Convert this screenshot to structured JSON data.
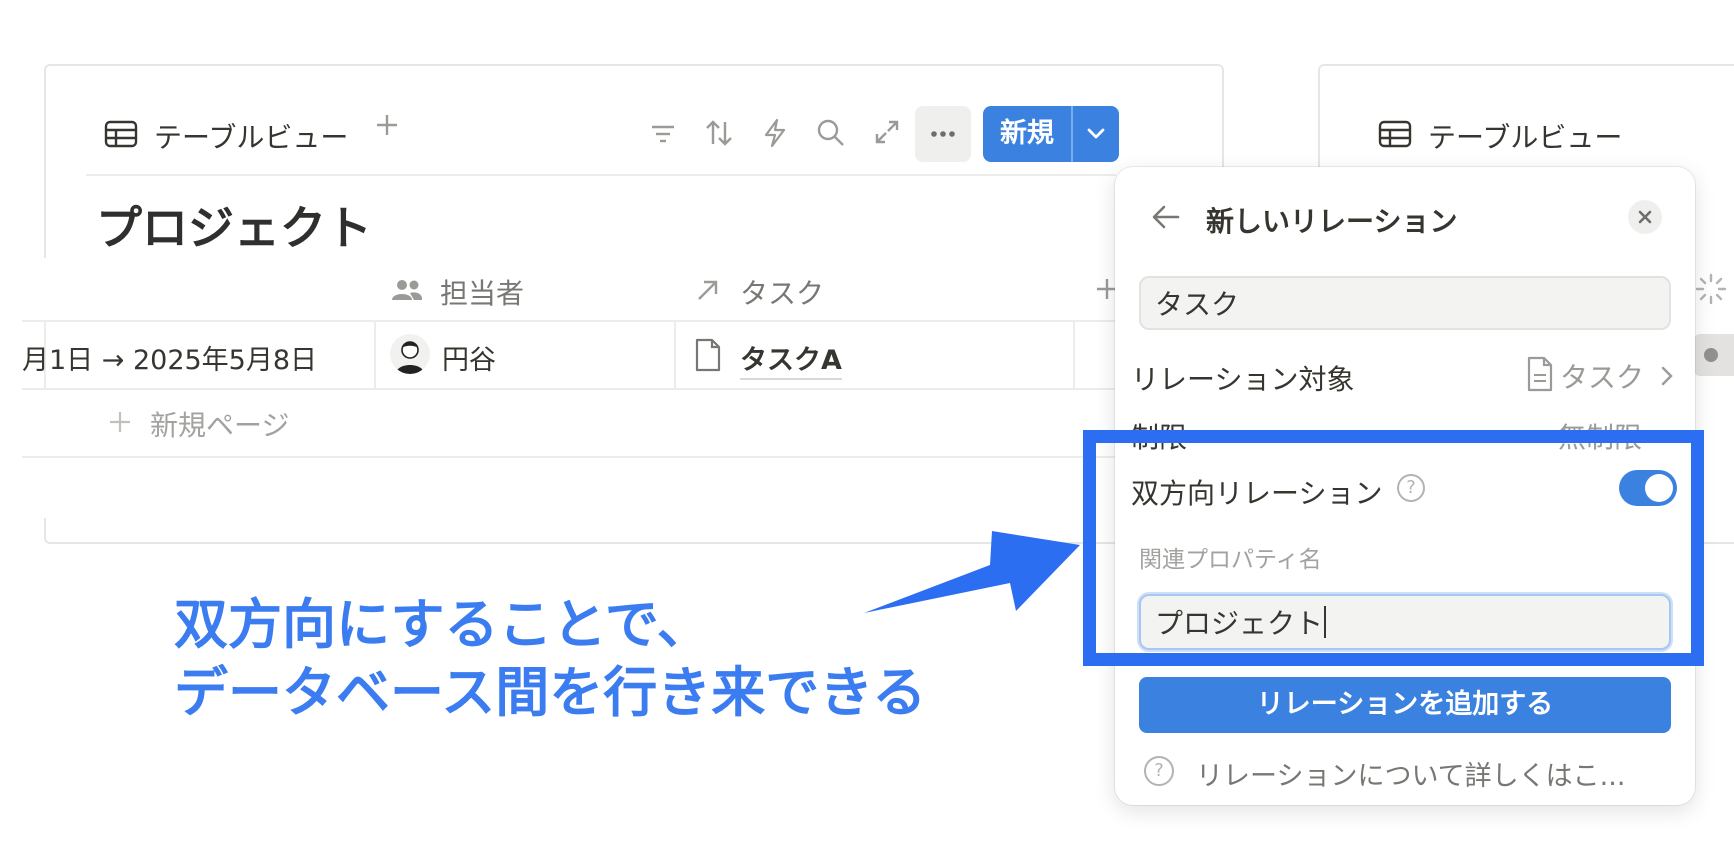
{
  "left_view": {
    "view_tab_label": "テーブルビュー",
    "new_button_label": "新規",
    "db_title": "プロジェクト",
    "columns": {
      "assignee": "担当者",
      "task": "タスク"
    },
    "row": {
      "date": "月1日 → 2025年5月8日",
      "assignee": "円谷",
      "task": "タスクA"
    },
    "new_page_label": "新規ページ"
  },
  "right_view": {
    "view_tab_label": "テーブルビュー"
  },
  "relation_panel": {
    "title": "新しいリレーション",
    "name_value": "タスク",
    "target_label": "リレーション対象",
    "target_value": "タスク",
    "limit_label": "制限",
    "limit_value": "無制限",
    "two_way_label": "双方向リレーション",
    "two_way_enabled": true,
    "related_prop_label": "関連プロパティ名",
    "related_prop_value": "プロジェクト",
    "add_button_label": "リレーションを追加する",
    "help_link": "リレーションについて詳しくはこ..."
  },
  "annotation": {
    "line1": "双方向にすることで、",
    "line2": "データベース間を行き来できる",
    "color": "#3b7df0",
    "highlight_color": "#2b6ef2"
  },
  "colors": {
    "accent": "#3b82e0"
  }
}
